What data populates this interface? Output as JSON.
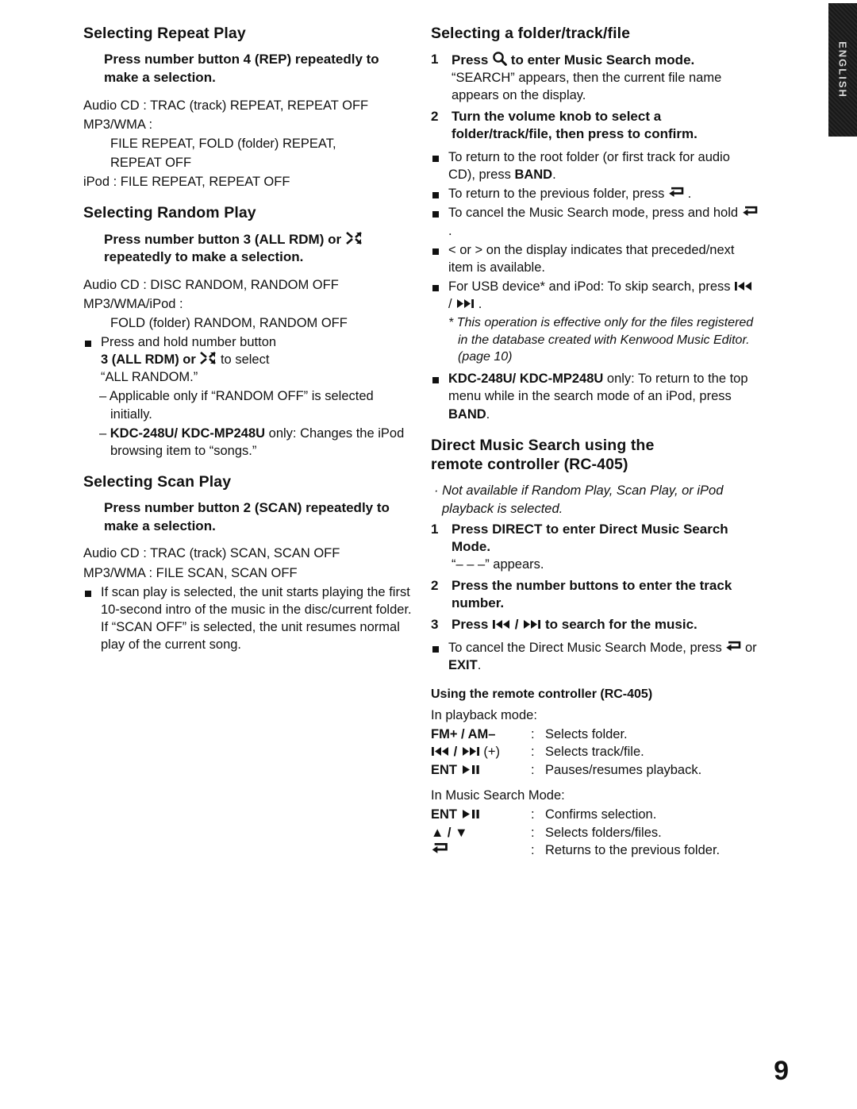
{
  "page": {
    "number": "9",
    "edge_label": "ENGLISH"
  },
  "left": {
    "repeat": {
      "heading": "Selecting Repeat Play",
      "lead": "Press number button 4 (REP) repeatedly to make a selection.",
      "lines": [
        "Audio CD : TRAC (track) REPEAT, REPEAT OFF",
        "MP3/WMA :",
        "FILE REPEAT, FOLD (folder) REPEAT,",
        "REPEAT OFF",
        "iPod : FILE REPEAT, REPEAT OFF"
      ]
    },
    "random": {
      "heading": "Selecting Random Play",
      "lead_a": "Press number button 3 (ALL RDM) or",
      "lead_b": "repeatedly to make a selection.",
      "lines": [
        "Audio CD : DISC RANDOM, RANDOM OFF",
        "MP3/WMA/iPod :",
        "FOLD (folder) RANDOM, RANDOM OFF"
      ],
      "bullet_1": "Press and hold number button",
      "bullet_1_b": "3 (ALL RDM) or",
      "bullet_1_c": "to select",
      "bullet_1_d": "“ALL RANDOM.”",
      "dash_1": "– Applicable only if “RANDOM OFF” is selected initially.",
      "dash_2_bold": "KDC-248U/ KDC-MP248U",
      "dash_2_rest": "only: Changes the iPod browsing item to “songs.”"
    },
    "scan": {
      "heading": "Selecting Scan Play",
      "lead": "Press number button 2 (SCAN) repeatedly to make a selection.",
      "lines": [
        "Audio CD : TRAC (track) SCAN, SCAN OFF",
        "MP3/WMA : FILE SCAN, SCAN OFF"
      ],
      "bullet": "If scan play is selected, the unit starts playing the first 10-second intro of the music in the disc/current folder.",
      "bullet_cont": "If “SCAN OFF” is selected, the unit resumes normal play of the current song."
    }
  },
  "right": {
    "folder": {
      "heading": "Selecting a folder/track/file",
      "step1_main_a": "Press",
      "step1_main_b": "to enter Music Search mode.",
      "step1_sub": "“SEARCH” appears, then the current file name appears on the display.",
      "step2_main": "Turn the volume knob to select a folder/track/file, then press to confirm.",
      "b1_a": "To return to the root folder (or first track for audio CD), press",
      "b1_bold": "BAND",
      "b1_end": ".",
      "b2": "To return to the previous folder, press",
      "b3": "To cancel the Music Search mode, press and hold",
      "b4": "< or > on the display indicates that preceded/next item is available.",
      "b5_a": "For USB device* and iPod: To skip search, press",
      "b5_sep": "/",
      "note": "* This operation is effective only for the files registered in the database created with Kenwood Music Editor. (page 10)",
      "b6_bold": "KDC-248U/ KDC-MP248U",
      "b6_rest": "only: To return to the top menu while in the search mode of an iPod, press",
      "b6_bold2": "BAND",
      "b6_end": "."
    },
    "direct": {
      "heading_l1": "Direct Music Search using the",
      "heading_l2": "remote controller (RC-405)",
      "note_italic": "· Not available if Random Play, Scan Play, or iPod playback is selected.",
      "step1_a": "Press",
      "step1_bold": "DIRECT",
      "step1_b": "to enter Direct Music Search Mode.",
      "step1_sub": "“– – –” appears.",
      "step2": "Press the number buttons to enter the track number.",
      "step3_a": "Press",
      "step3_sep": "/",
      "step3_b": "to search for the music.",
      "bullet_a": "To cancel the Direct Music Search Mode, press",
      "bullet_or": "or",
      "bullet_bold": "EXIT",
      "bullet_end": "."
    },
    "remote": {
      "heading": "Using the remote controller (RC-405)",
      "mode1": "In playback mode:",
      "rows1": [
        {
          "key": "FM+ / AM–",
          "colon": ":",
          "value": "Selects folder."
        },
        {
          "key": "(+)",
          "colon": ":",
          "value": "Selects track/file.",
          "icon": "skip-both-plus"
        },
        {
          "key": "ENT",
          "colon": ":",
          "value": "Pauses/resumes playback.",
          "icon": "play-pause"
        }
      ],
      "mode2": "In Music Search Mode:",
      "rows2": [
        {
          "key": "ENT",
          "colon": ":",
          "value": "Confirms selection.",
          "icon": "play-pause"
        },
        {
          "key": "▲ / ▼",
          "colon": ":",
          "value": "Selects folders/files."
        },
        {
          "key": "",
          "colon": ":",
          "value": "Returns to the previous folder.",
          "icon": "return-arrow"
        }
      ]
    }
  }
}
